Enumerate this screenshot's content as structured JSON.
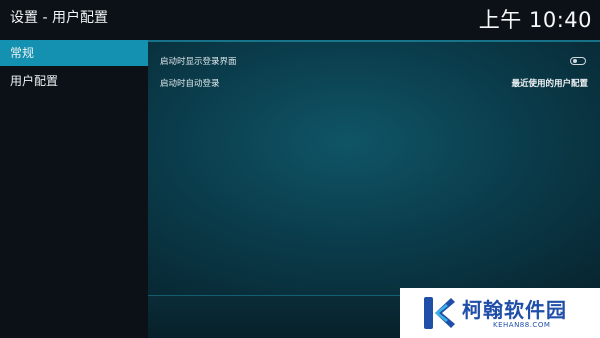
{
  "header": {
    "title": "设置 - 用户配置",
    "clock": "上午 10:40"
  },
  "sidebar": {
    "items": [
      {
        "label": "常规",
        "active": true
      },
      {
        "label": "用户配置",
        "active": false
      }
    ]
  },
  "settings": {
    "show_login_screen": {
      "label": "启动时显示登录界面",
      "toggle_on": false
    },
    "auto_login": {
      "label": "启动时自动登录",
      "value": "最近使用的用户配置"
    }
  },
  "watermark": {
    "name": "柯翰软件园",
    "url": "KEHAN88.COM"
  },
  "colors": {
    "accent": "#1490b0",
    "watermark_blue": "#1f4fa8"
  }
}
